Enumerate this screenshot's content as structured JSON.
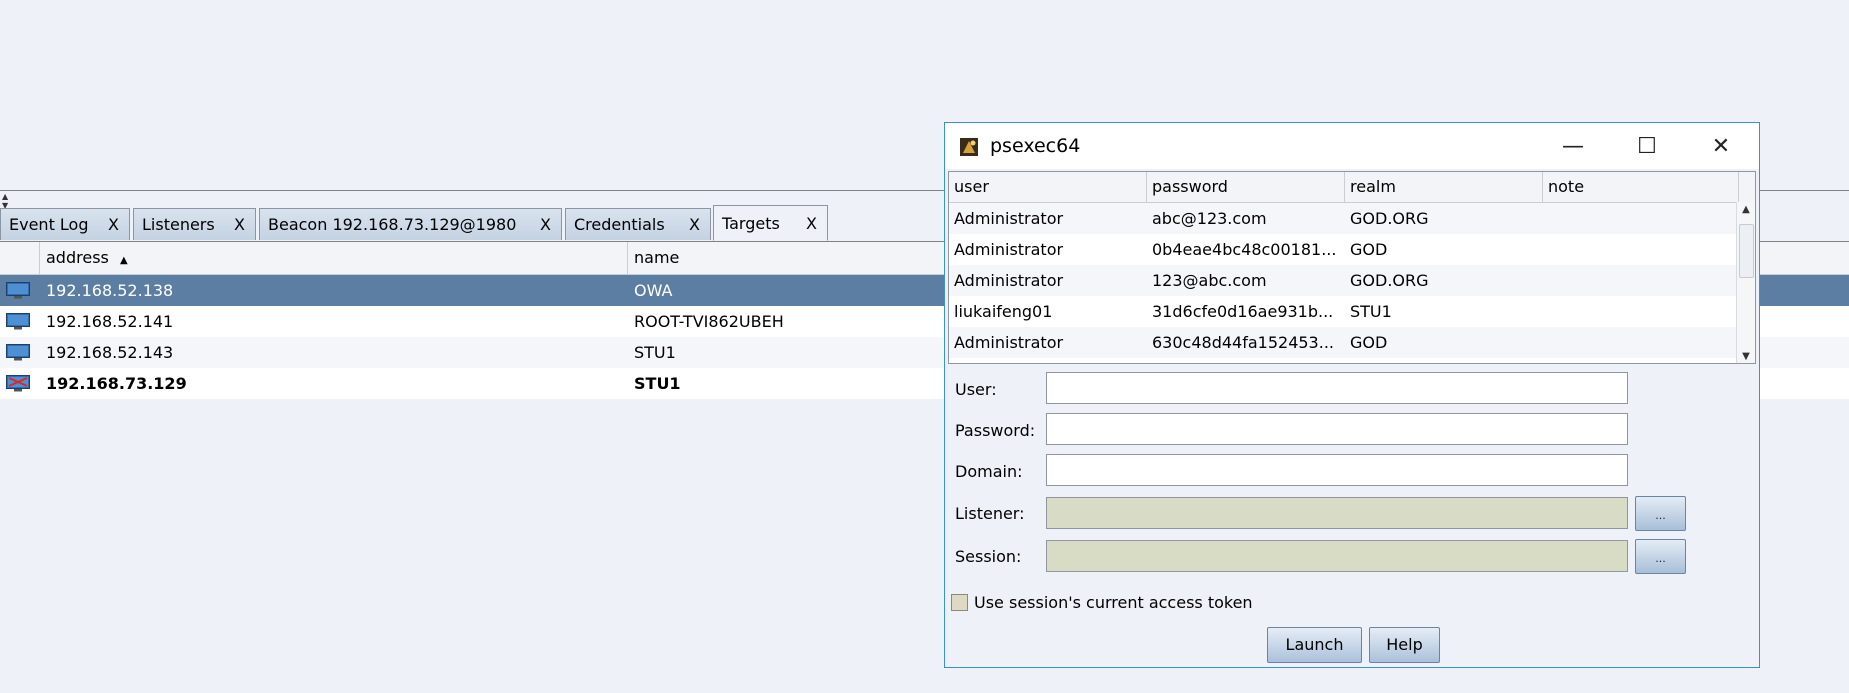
{
  "tabs": [
    {
      "label": "Event Log",
      "close": "X"
    },
    {
      "label": "Listeners",
      "close": "X"
    },
    {
      "label": "Beacon 192.168.73.129@1980",
      "close": "X"
    },
    {
      "label": "Credentials",
      "close": "X"
    },
    {
      "label": "Targets",
      "close": "X"
    }
  ],
  "targets": {
    "columns": {
      "address": "address",
      "sort_indicator": "▲",
      "name": "name"
    },
    "rows": [
      {
        "address": "192.168.52.138",
        "name": "OWA"
      },
      {
        "address": "192.168.52.141",
        "name": "ROOT-TVI862UBEH"
      },
      {
        "address": "192.168.52.143",
        "name": "STU1"
      },
      {
        "address": "192.168.73.129",
        "name": "STU1"
      }
    ]
  },
  "dialog": {
    "title": "psexec64",
    "window_buttons": {
      "minimize": "—",
      "maximize": "☐",
      "close": "✕"
    },
    "cred_columns": {
      "user": "user",
      "password": "password",
      "realm": "realm",
      "note": "note"
    },
    "credentials": [
      {
        "user": "Administrator",
        "password": "abc@123.com",
        "realm": "GOD.ORG",
        "note": ""
      },
      {
        "user": "Administrator",
        "password": "0b4eae4bc48c00181...",
        "realm": "GOD",
        "note": ""
      },
      {
        "user": "Administrator",
        "password": "123@abc.com",
        "realm": "GOD.ORG",
        "note": ""
      },
      {
        "user": "liukaifeng01",
        "password": "31d6cfe0d16ae931b...",
        "realm": "STU1",
        "note": ""
      },
      {
        "user": "Administrator",
        "password": "630c48d44fa152453...",
        "realm": "GOD",
        "note": ""
      }
    ],
    "fields": {
      "user": {
        "label": "User:",
        "value": ""
      },
      "password": {
        "label": "Password:",
        "value": ""
      },
      "domain": {
        "label": "Domain:",
        "value": ""
      },
      "listener": {
        "label": "Listener:",
        "value": ""
      },
      "session": {
        "label": "Session:",
        "value": ""
      }
    },
    "ellipsis": "...",
    "checkbox_label": "Use session's current access token",
    "launch": "Launch",
    "help": "Help"
  }
}
